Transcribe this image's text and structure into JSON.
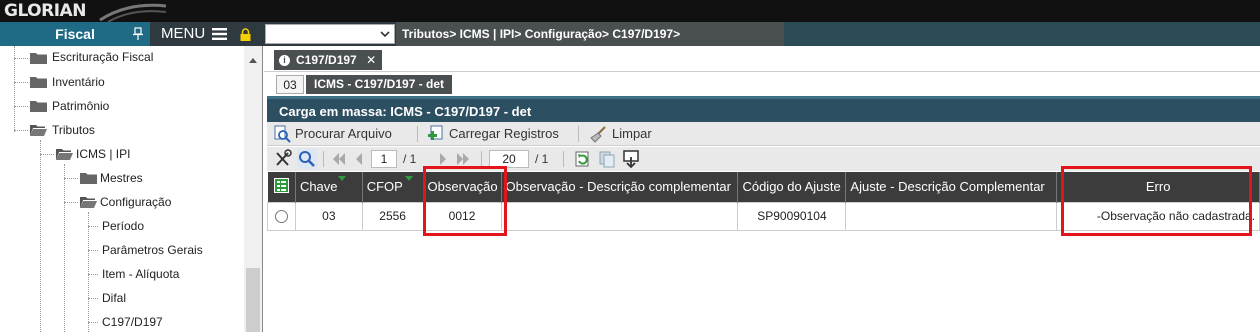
{
  "app": {
    "logo": "GLORIAN"
  },
  "header": {
    "module": "Fiscal",
    "menu_label": "MENU"
  },
  "breadcrumb": "Tributos> ICMS | IPI> Configuração> C197/D197>",
  "tree": {
    "items": [
      {
        "label": "Escrituração Fiscal",
        "level": 1,
        "kind": "folder"
      },
      {
        "label": "Inventário",
        "level": 1,
        "kind": "folder"
      },
      {
        "label": "Patrimônio",
        "level": 1,
        "kind": "folder"
      },
      {
        "label": "Tributos",
        "level": 1,
        "kind": "folder-open"
      },
      {
        "label": "ICMS | IPI",
        "level": 2,
        "kind": "folder-open"
      },
      {
        "label": "Mestres",
        "level": 3,
        "kind": "folder"
      },
      {
        "label": "Configuração",
        "level": 3,
        "kind": "folder-open"
      },
      {
        "label": "Período",
        "level": 4,
        "kind": "leaf"
      },
      {
        "label": "Parâmetros Gerais",
        "level": 4,
        "kind": "leaf"
      },
      {
        "label": "Item - Alíquota",
        "level": 4,
        "kind": "leaf"
      },
      {
        "label": "Difal",
        "level": 4,
        "kind": "leaf"
      },
      {
        "label": "C197/D197",
        "level": 4,
        "kind": "leaf"
      }
    ]
  },
  "tab": {
    "label": "C197/D197",
    "close": "✕"
  },
  "subtab": {
    "number": "03",
    "label": "ICMS - C197/D197 - det"
  },
  "panel": {
    "title": "Carga em massa: ICMS - C197/D197 - det"
  },
  "actions": {
    "browse": "Procurar Arquivo",
    "load": "Carregar Registros",
    "clear": "Limpar"
  },
  "pager": {
    "page": "1",
    "page_total": "/ 1",
    "rows_per_page": "20",
    "rows_total": "/ 1"
  },
  "table": {
    "columns": [
      "Chave",
      "CFOP",
      "Observação",
      "Observação - Descrição complementar",
      "Código do Ajuste",
      "Ajuste - Descrição Complementar",
      "Erro"
    ],
    "rows": [
      {
        "chave": "03",
        "cfop": "2556",
        "observacao": "0012",
        "obs_desc": "",
        "codigo_ajuste": "SP90090104",
        "ajuste_desc": "",
        "erro": "-Observação não cadastrada."
      }
    ]
  },
  "colors": {
    "module_bg": "#1f6b86",
    "panel_header": "#2d4f62",
    "table_header": "#3c3c3c",
    "highlight": "#e3141c"
  }
}
